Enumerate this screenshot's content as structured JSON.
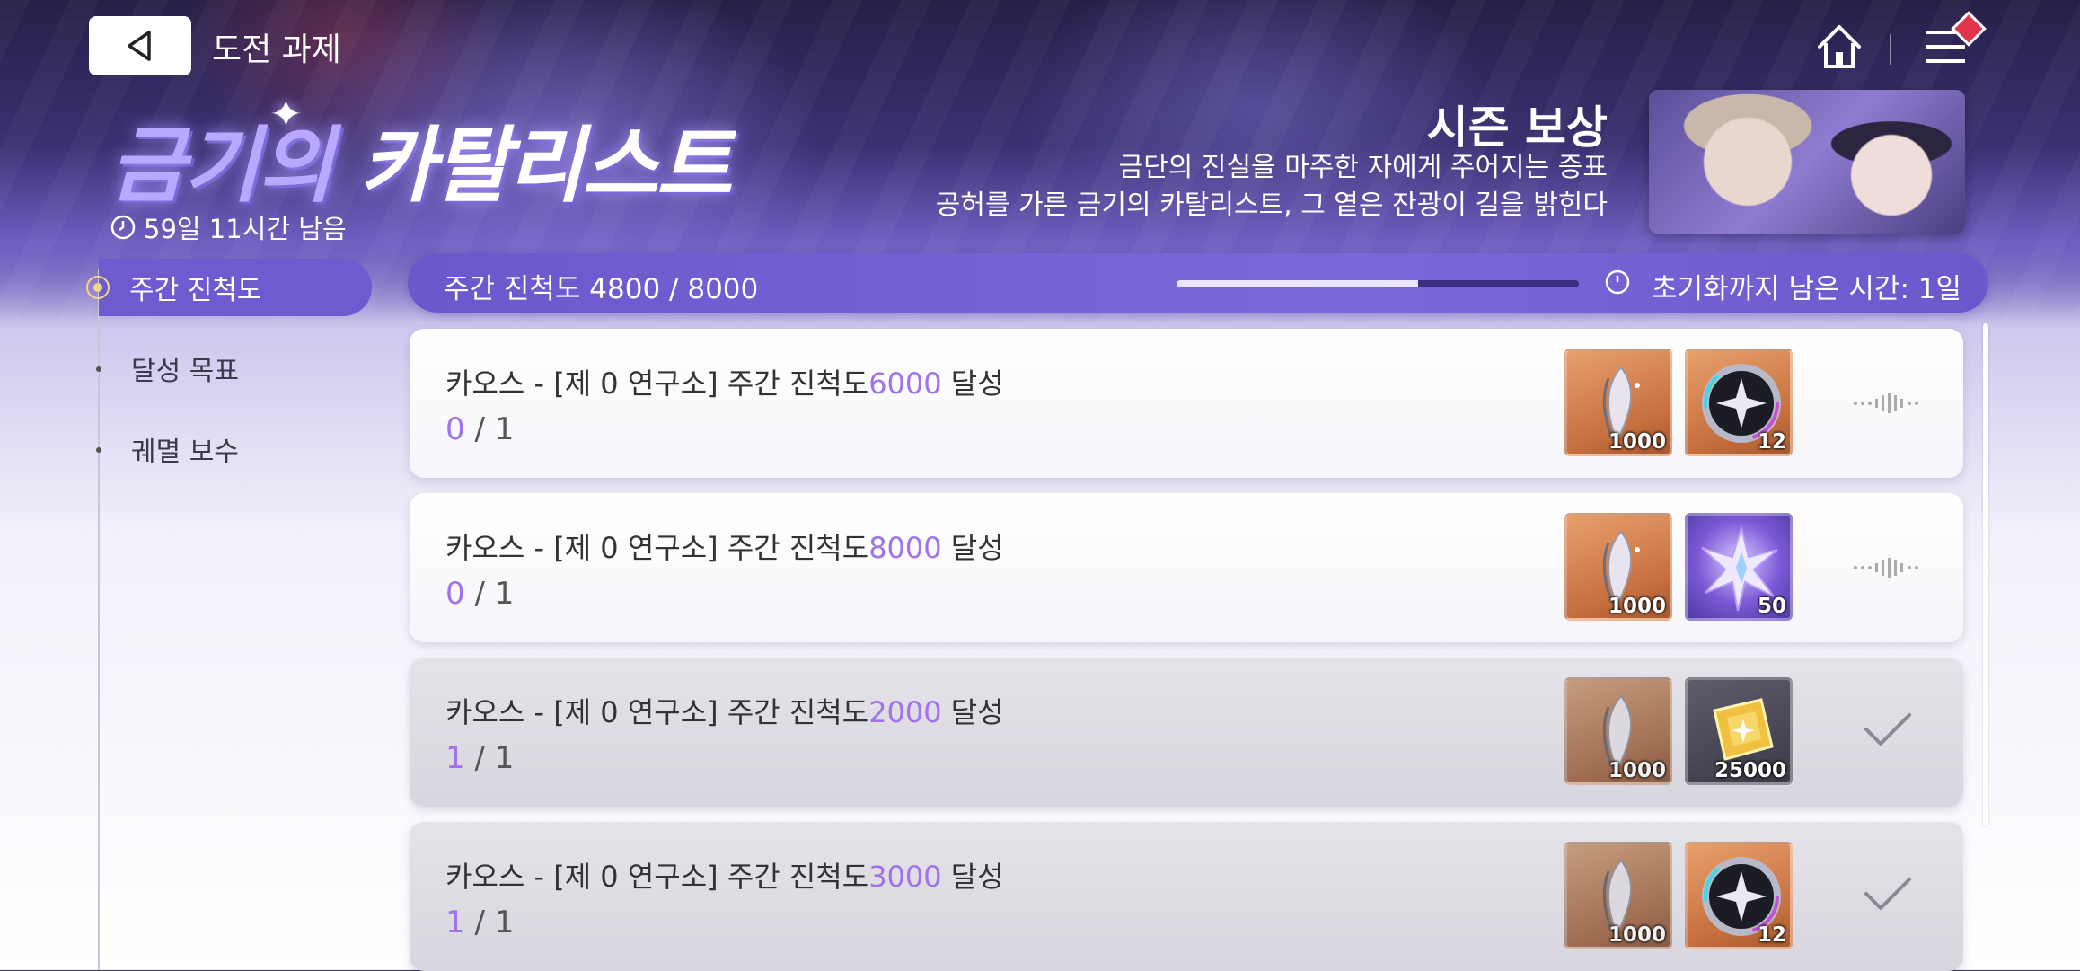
{
  "header": {
    "page_title": "도전 과제"
  },
  "event": {
    "logo_part1": "금기의",
    "logo_part2": "카탈리스트",
    "remaining": "59일 11시간 남음"
  },
  "season": {
    "title": "시즌 보상",
    "desc_line1": "금단의 진실을 마주한 자에게 주어지는 증표",
    "desc_line2": "공허를 가른 금기의 카탈리스트, 그 옅은 잔광이 길을 밝힌다"
  },
  "sidebar": {
    "items": [
      {
        "label": "주간 진척도",
        "active": true
      },
      {
        "label": "달성 목표",
        "active": false
      },
      {
        "label": "궤멸 보수",
        "active": false
      }
    ]
  },
  "progress": {
    "label": "주간 진척도 4800 / 8000",
    "current": 4800,
    "max": 8000,
    "reset_text": "초기화까지 남은 시간: 1일"
  },
  "quests": [
    {
      "prefix": "카오스 - [제 0 연구소] 주간 진척도",
      "goal": "6000",
      "suffix": " 달성",
      "current": "0",
      "total": " / 1",
      "status": "in-progress",
      "rewards": [
        {
          "icon": "feather-icon",
          "qty": "1000"
        },
        {
          "icon": "compass-icon",
          "qty": "12"
        }
      ]
    },
    {
      "prefix": "카오스 - [제 0 연구소] 주간 진척도",
      "goal": "8000",
      "suffix": " 달성",
      "current": "0",
      "total": " / 1",
      "status": "in-progress",
      "rewards": [
        {
          "icon": "feather-icon",
          "qty": "1000"
        },
        {
          "icon": "crystal-icon",
          "qty": "50"
        }
      ]
    },
    {
      "prefix": "카오스 - [제 0 연구소] 주간 진척도",
      "goal": "2000",
      "suffix": " 달성",
      "current": "1",
      "total": " / 1",
      "status": "completed",
      "rewards": [
        {
          "icon": "feather-icon",
          "qty": "1000"
        },
        {
          "icon": "gold-cube-icon",
          "qty": "25000"
        }
      ]
    },
    {
      "prefix": "카오스 - [제 0 연구소] 주간 진척도",
      "goal": "3000",
      "suffix": " 달성",
      "current": "1",
      "total": " / 1",
      "status": "completed",
      "rewards": [
        {
          "icon": "feather-icon",
          "qty": "1000"
        },
        {
          "icon": "compass-icon",
          "qty": "12"
        }
      ]
    }
  ],
  "colors": {
    "accent": "#6d5bd0",
    "goal_text": "#a173e8",
    "badge": "#e2334d"
  }
}
